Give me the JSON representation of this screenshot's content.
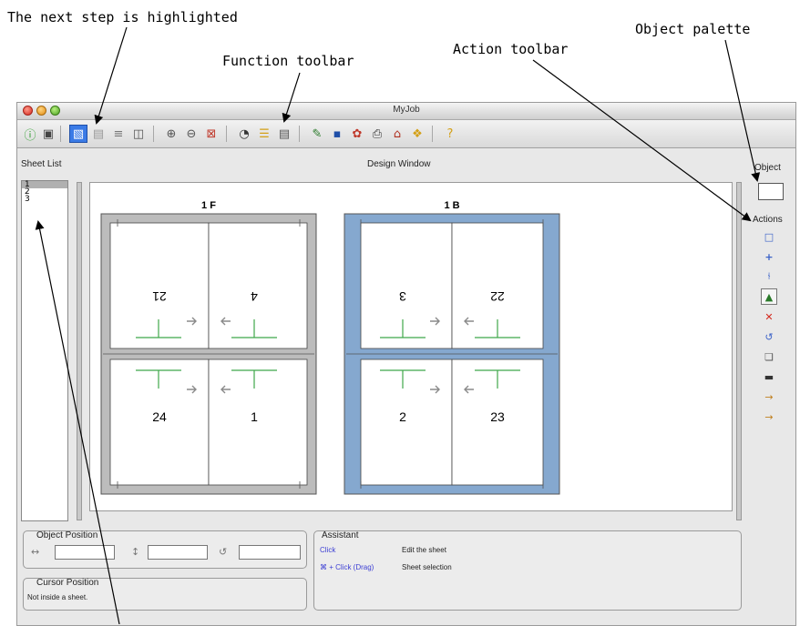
{
  "callouts": {
    "next_step": "The next step is highlighted",
    "function_toolbar": "Function toolbar",
    "action_toolbar": "Action toolbar",
    "object_palette": "Object palette"
  },
  "window": {
    "title": "MyJob"
  },
  "toolbar": {
    "icons": [
      "info-icon",
      "save-icon",
      "sheet-view-icon",
      "layout-icon",
      "stack-icon",
      "multi-sheet-icon",
      "zoom-in-icon",
      "zoom-out-icon",
      "zoom-fit-icon",
      "color-wheel-icon",
      "layers-icon",
      "stack-print-icon",
      "edit-icon",
      "page-icon",
      "settings-icon",
      "print-icon",
      "shop-icon",
      "tag-icon",
      "help-icon"
    ]
  },
  "labels": {
    "sheet_list": "Sheet List",
    "design_window": "Design Window",
    "object": "Object",
    "actions": "Actions"
  },
  "sheet_list": {
    "items": [
      "1",
      "2",
      "3"
    ]
  },
  "sheets": [
    {
      "label": "1 F",
      "pages_top": [
        "21",
        "4"
      ],
      "pages_bottom": [
        "24",
        "1"
      ],
      "frame_color": "#bcbcbc"
    },
    {
      "label": "1 B",
      "pages_top": [
        "3",
        "22"
      ],
      "pages_bottom": [
        "2",
        "23"
      ],
      "frame_color": "#85a8cf"
    }
  ],
  "actions": {
    "icons": [
      "frame-icon",
      "add-icon",
      "split-icon",
      "marks-icon",
      "delete-icon",
      "rotate-icon",
      "copy-icon",
      "fill-icon",
      "move-in-icon",
      "move-out-icon"
    ]
  },
  "object_position": {
    "title": "Object Position",
    "x_value": "",
    "y_value": "",
    "rotation_value": ""
  },
  "cursor_position": {
    "title": "Cursor Position",
    "text": "Not inside a sheet."
  },
  "assistant": {
    "title": "Assistant",
    "rows": [
      {
        "action": "Click",
        "description": "Edit the sheet"
      },
      {
        "action": "⌘ + Click (Drag)",
        "description": "Sheet selection"
      }
    ]
  },
  "colors": {
    "accent": "#3b7be6",
    "assistant_link": "#3d3fd4",
    "mark_green": "#3fa84a",
    "arrow_gray": "#8a8a8a"
  }
}
